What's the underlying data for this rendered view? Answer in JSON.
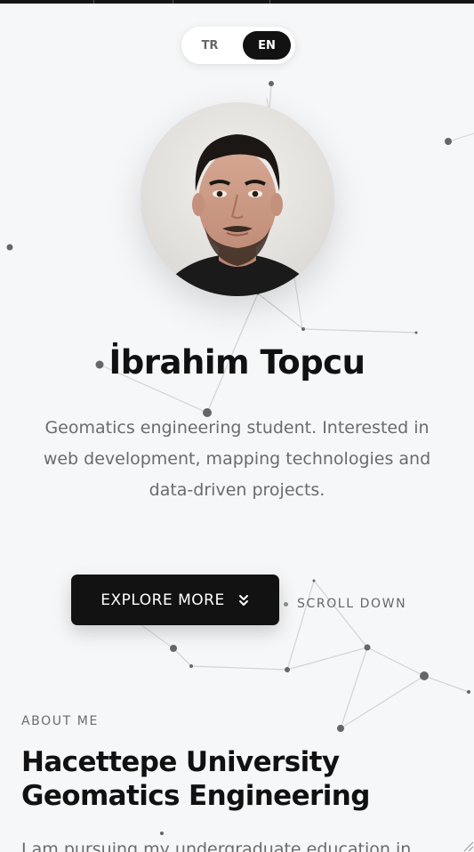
{
  "lang_toggle": {
    "tr_label": "TR",
    "en_label": "EN",
    "active": "EN"
  },
  "profile": {
    "name": "İbrahim Topcu",
    "bio": "Geomatics engineering student. Interested in web development, mapping technologies and data-driven projects."
  },
  "hero": {
    "explore_label": "EXPLORE MORE",
    "explore_icon": "chevrons-down-icon",
    "scroll_label": "SCROLL DOWN"
  },
  "about": {
    "label": "ABOUT ME",
    "title": "Hacettepe University Geomatics Engineering",
    "text": "I am pursuing my undergraduate education in"
  },
  "colors": {
    "background": "#f6f7f9",
    "primary": "#121212",
    "muted_text": "#6b6b6b",
    "network_line": "#d3d3d3",
    "network_node": "#666666"
  }
}
